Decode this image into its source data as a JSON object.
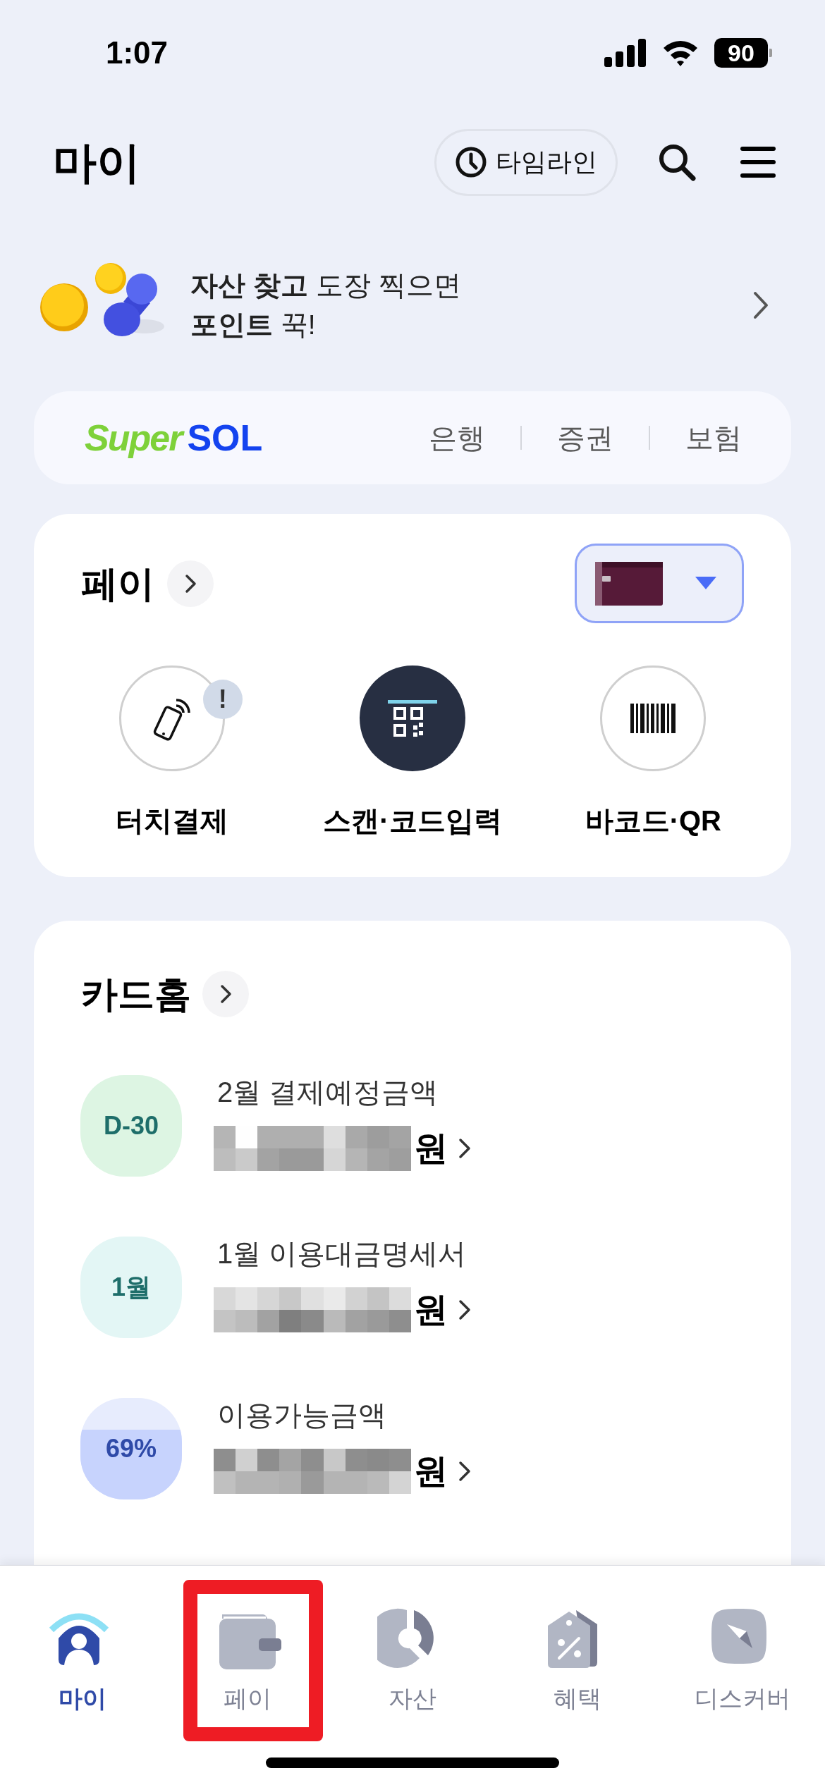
{
  "status_bar": {
    "time": "1:07",
    "battery": "90"
  },
  "header": {
    "title": "마이",
    "timeline_button": "타임라인"
  },
  "promo": {
    "lines": [
      "**자산 찾고** 도장 찍으면",
      "**포인트** 꾹!"
    ]
  },
  "supersol": {
    "logo_super": "Super",
    "logo_sol": "SOL",
    "links": [
      "은행",
      "증권",
      "보험"
    ]
  },
  "pay": {
    "title": "페이",
    "actions": [
      {
        "label": "터치결제",
        "kind": "touch",
        "badge": "!"
      },
      {
        "label": "스캔·코드입력",
        "kind": "scan"
      },
      {
        "label": "바코드·QR",
        "kind": "barcode"
      }
    ]
  },
  "card_home": {
    "title": "카드홈",
    "rows": [
      {
        "kind": "due",
        "badge": "D-30",
        "label": "2월 결제예정금액",
        "unit": "원"
      },
      {
        "kind": "statement",
        "badge": "1월",
        "label": "1월 이용대금명세서",
        "unit": "원"
      },
      {
        "kind": "limit",
        "badge": "69%",
        "label": "이용가능금액",
        "unit": "원"
      }
    ]
  },
  "nav": [
    {
      "kind": "home",
      "label": "마이",
      "selected": true,
      "highlighted": false
    },
    {
      "kind": "wallet",
      "label": "페이",
      "selected": false,
      "highlighted": true
    },
    {
      "kind": "asset",
      "label": "자산",
      "selected": false,
      "highlighted": false
    },
    {
      "kind": "benefit",
      "label": "혜택",
      "selected": false,
      "highlighted": false
    },
    {
      "kind": "discover",
      "label": "디스커버",
      "selected": false,
      "highlighted": false
    }
  ]
}
